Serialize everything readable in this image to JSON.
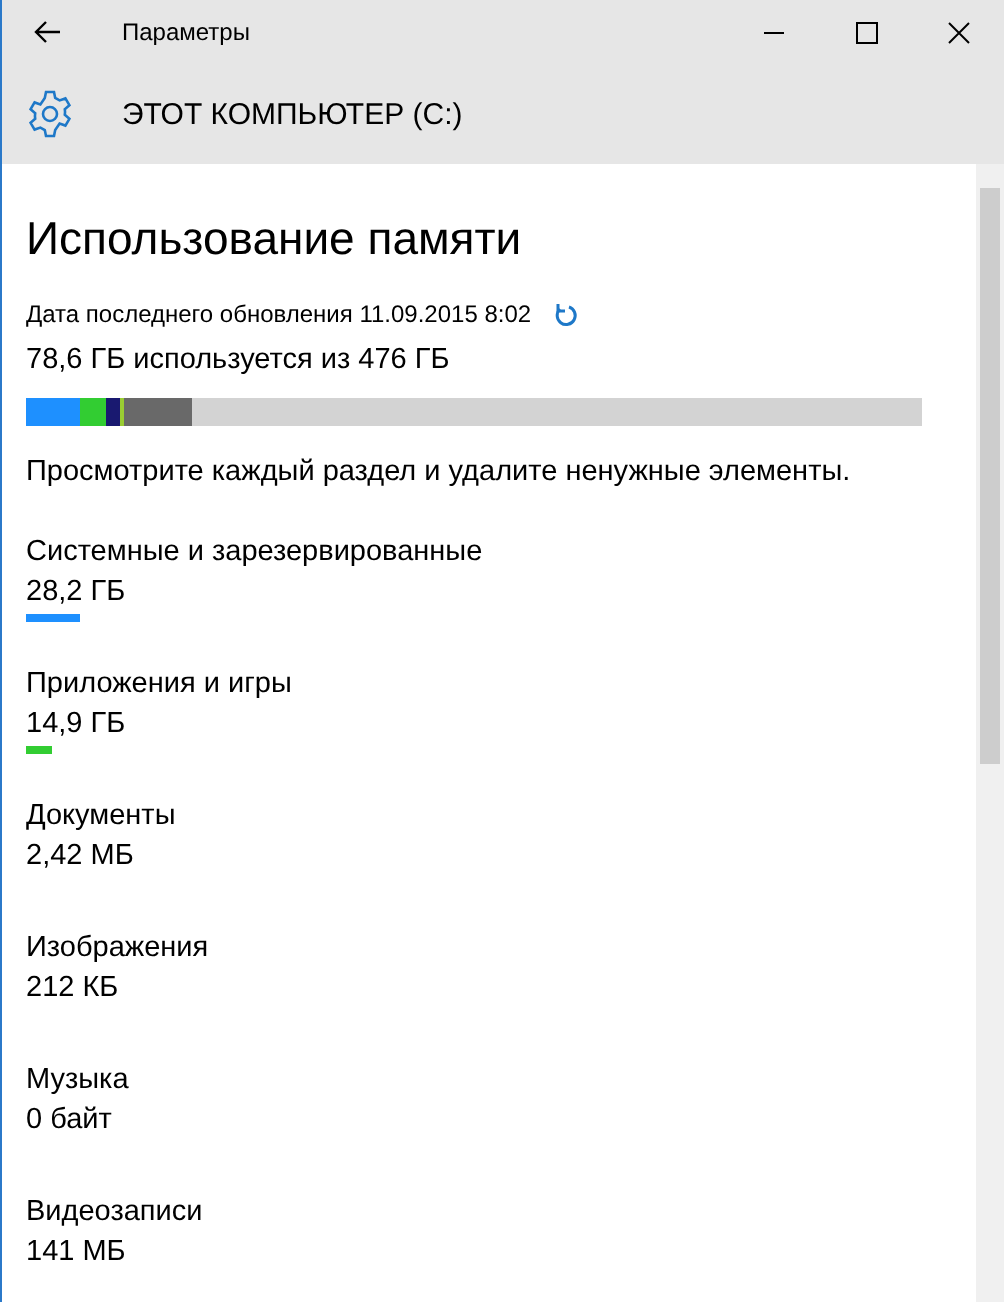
{
  "window": {
    "title": "Параметры"
  },
  "header": {
    "title": "ЭТОТ КОМПЬЮТЕР (C:)"
  },
  "page": {
    "heading": "Использование памяти",
    "updated": "Дата последнего обновления 11.09.2015 8:02",
    "usage": "78,6 ГБ используется из 476 ГБ",
    "segments": [
      {
        "color": "#1e90ff"
      },
      {
        "color": "#32cd32"
      },
      {
        "color": "#191970"
      },
      {
        "color": "#9acd32"
      },
      {
        "color": "#696969"
      }
    ],
    "description": "Просмотрите каждый раздел и удалите ненужные элементы.",
    "categories": [
      {
        "name": "Системные и зарезервированные",
        "size": "28,2 ГБ",
        "color": "#1e90ff"
      },
      {
        "name": "Приложения и игры",
        "size": "14,9 ГБ",
        "color": "#32cd32"
      },
      {
        "name": "Документы",
        "size": "2,42 МБ"
      },
      {
        "name": "Изображения",
        "size": "212 КБ"
      },
      {
        "name": "Музыка",
        "size": "0 байт"
      },
      {
        "name": "Видеозаписи",
        "size": "141 МБ"
      }
    ]
  }
}
